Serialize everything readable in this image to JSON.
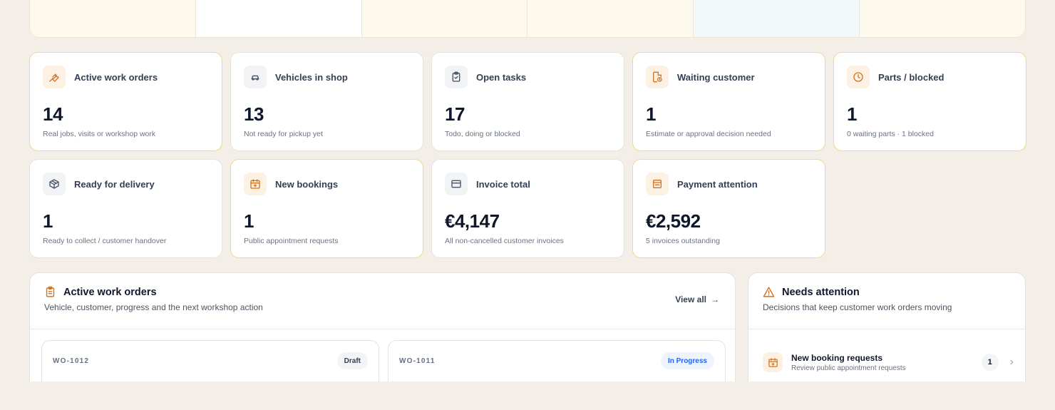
{
  "stats": [
    {
      "title": "Active work orders",
      "value": "14",
      "sub": "Real jobs, visits or workshop work",
      "icon": "wrench-icon"
    },
    {
      "title": "Vehicles in shop",
      "value": "13",
      "sub": "Not ready for pickup yet",
      "icon": "car-icon"
    },
    {
      "title": "Open tasks",
      "value": "17",
      "sub": "Todo, doing or blocked",
      "icon": "clipboard-check-icon"
    },
    {
      "title": "Waiting customer",
      "value": "1",
      "sub": "Estimate or approval decision needed",
      "icon": "file-clock-icon"
    },
    {
      "title": "Parts / blocked",
      "value": "1",
      "sub": "0 waiting parts · 1 blocked",
      "icon": "clock-icon"
    },
    {
      "title": "Ready for delivery",
      "value": "1",
      "sub": "Ready to collect / customer handover",
      "icon": "package-icon"
    },
    {
      "title": "New bookings",
      "value": "1",
      "sub": "Public appointment requests",
      "icon": "calendar-plus-icon"
    },
    {
      "title": "Invoice total",
      "value": "€4,147",
      "sub": "All non-cancelled customer invoices",
      "icon": "credit-card-icon"
    },
    {
      "title": "Payment attention",
      "value": "€2,592",
      "sub": "5 invoices outstanding",
      "icon": "wallet-icon"
    }
  ],
  "active_orders": {
    "title": "Active work orders",
    "subtitle": "Vehicle, customer, progress and the next workshop action",
    "view_all": "View all",
    "orders": [
      {
        "id": "WO-1012",
        "status": "Draft"
      },
      {
        "id": "WO-1011",
        "status": "In Progress"
      }
    ]
  },
  "attention": {
    "title": "Needs attention",
    "subtitle": "Decisions that keep customer work orders moving",
    "items": [
      {
        "title": "New booking requests",
        "sub": "Review public appointment requests",
        "count": "1"
      }
    ]
  },
  "colors": {
    "accent": "#d4731d",
    "warn_border": "#f6d68a",
    "background": "#f3efe8"
  }
}
